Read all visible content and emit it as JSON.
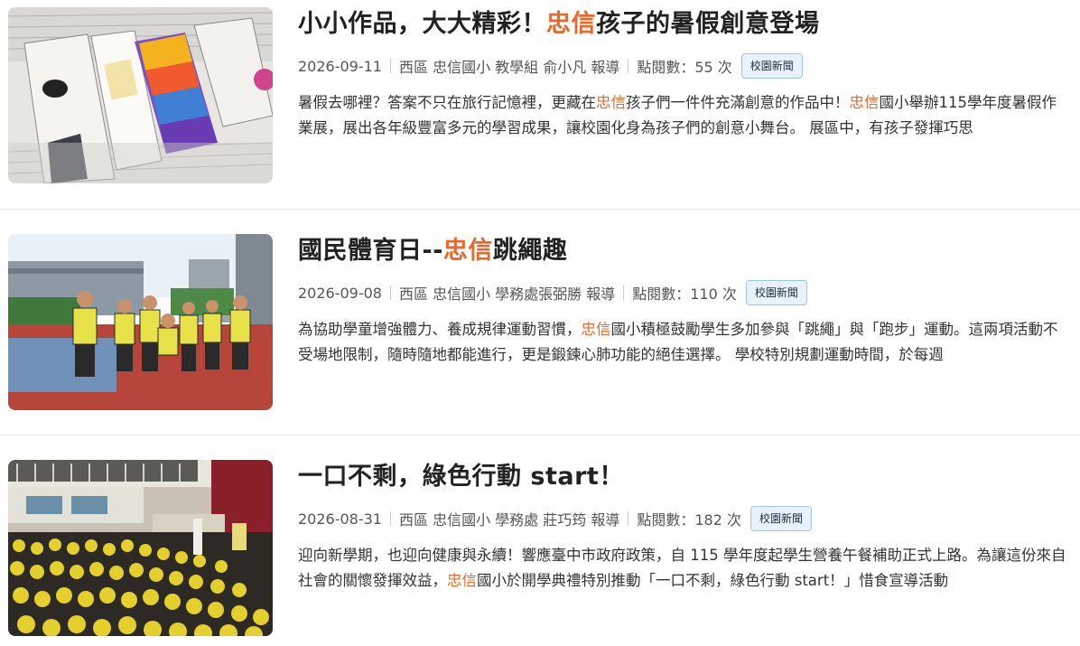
{
  "highlight_color": "#e9692c",
  "articles": [
    {
      "thumbnail": "bookmark-artwork-photo",
      "title_pre": "小小作品，大大精彩！",
      "title_hl": "忠信",
      "title_post": "孩子的暑假創意登場",
      "date": "2026-09-11",
      "source": "西區 忠信國小 教學組 俞小凡 報導",
      "views": "點閱數：55 次",
      "tag": "校園新聞",
      "ex_1": "暑假去哪裡？答案不只在旅行記憶裡，更藏在",
      "ex_hl_1": "忠信",
      "ex_2": "孩子們一件件充滿創意的作品中！",
      "ex_hl_2": "忠信",
      "ex_3": "國小舉辦115學年度暑假作業展，展出各年級豐富多元的學習成果，讓校園化身為孩子們的創意小舞台。 展區中，有孩子發揮巧思"
    },
    {
      "thumbnail": "students-jump-rope-photo",
      "title_pre": "國民體育日--",
      "title_hl": "忠信",
      "title_post": "跳繩趣",
      "date": "2026-09-08",
      "source": "西區 忠信國小 學務處張弼勝 報導",
      "views": "點閱數：110 次",
      "tag": "校園新聞",
      "ex_1": "為協助學童增強體力、養成規律運動習慣，",
      "ex_hl_1": "忠信",
      "ex_2": "國小積極鼓勵學生多加參與「跳繩」與「跑步」運動。這兩項活動不受場地限制，隨時隨地都能進行，更是鍛鍊心肺功能的絕佳選擇。 學校特別規劃運動時間，於每週",
      "ex_hl_2": "",
      "ex_3": ""
    },
    {
      "thumbnail": "assembly-hall-photo",
      "title_pre": "一口不剩，綠色行動 start！",
      "title_hl": "",
      "title_post": "",
      "date": "2026-08-31",
      "source": "西區 忠信國小 學務處 莊巧筠 報導",
      "views": "點閱數：182 次",
      "tag": "校園新聞",
      "ex_1": "迎向新學期，也迎向健康與永續！響應臺中市政府政策，自 115 學年度起學生營養午餐補助正式上路。為讓這份來自社會的關懷發揮效益，",
      "ex_hl_1": "忠信",
      "ex_2": "國小於開學典禮特別推動「一口不剩，綠色行動 start！」惜食宣導活動",
      "ex_hl_2": "",
      "ex_3": ""
    }
  ]
}
